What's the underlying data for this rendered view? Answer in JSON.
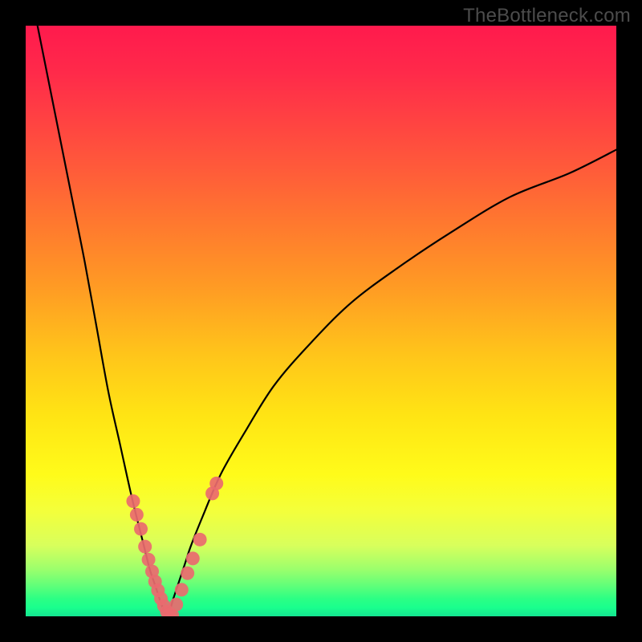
{
  "watermark": "TheBottleneck.com",
  "colors": {
    "page_bg": "#000000",
    "curve": "#000000",
    "marker_fill": "#ea6a6f",
    "marker_stroke": "#ea6a6f",
    "gradient_top": "#ff1a4d",
    "gradient_bottom": "#14e490"
  },
  "chart_data": {
    "type": "line",
    "title": "",
    "xlabel": "",
    "ylabel": "",
    "xlim": [
      0,
      100
    ],
    "ylim": [
      0,
      100
    ],
    "legend": false,
    "grid": false,
    "notes": "V-shaped black curve on rainbow gradient; minimum at approximately x≈24, y≈0. Salmon-colored markers cluster near the valley on both branches. Axes are unlabeled.",
    "series": [
      {
        "name": "curve-left-branch",
        "x": [
          2,
          4,
          6,
          8,
          10,
          12,
          14,
          16,
          18,
          20,
          21,
          22,
          23,
          24
        ],
        "y": [
          100,
          90,
          80,
          70,
          60,
          49,
          38,
          29,
          20,
          12,
          8,
          5,
          2,
          0
        ]
      },
      {
        "name": "curve-right-branch",
        "x": [
          24,
          25,
          26,
          27,
          28,
          30,
          33,
          37,
          42,
          48,
          55,
          63,
          72,
          82,
          92,
          100
        ],
        "y": [
          0,
          3,
          6,
          9,
          12,
          17,
          24,
          31,
          39,
          46,
          53,
          59,
          65,
          71,
          75,
          79
        ]
      }
    ],
    "markers": {
      "name": "sample-points",
      "x": [
        18.2,
        18.8,
        19.5,
        20.2,
        20.8,
        21.4,
        21.9,
        22.4,
        22.9,
        23.4,
        23.9,
        24.3,
        24.8,
        25.5,
        26.4,
        27.4,
        28.3,
        29.5,
        31.6,
        32.3
      ],
      "y": [
        19.5,
        17.2,
        14.8,
        11.8,
        9.6,
        7.6,
        5.9,
        4.4,
        3.0,
        1.8,
        0.8,
        0.3,
        0.2,
        2.0,
        4.5,
        7.3,
        9.8,
        13.0,
        20.8,
        22.5
      ]
    }
  }
}
